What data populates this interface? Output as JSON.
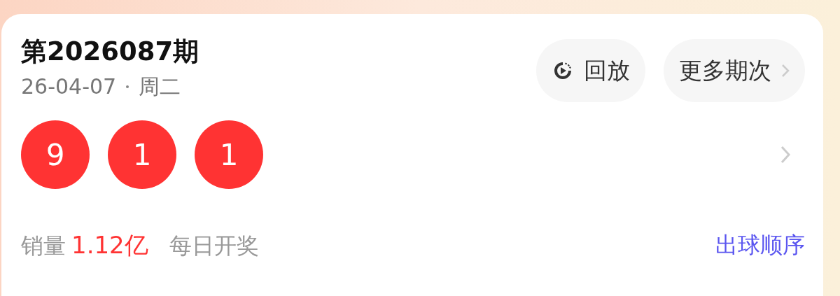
{
  "issue": {
    "title": "第2026087期",
    "date": "26-04-07",
    "weekday": "周二"
  },
  "buttons": [
    {
      "kind": "replay",
      "label": "回放"
    },
    {
      "kind": "more",
      "label": "更多期次"
    }
  ],
  "balls": [
    "9",
    "1",
    "1"
  ],
  "footer": {
    "sales_label": "销量",
    "sales_value": "1.12亿",
    "schedule": "每日开奖",
    "link": "出球顺序"
  }
}
